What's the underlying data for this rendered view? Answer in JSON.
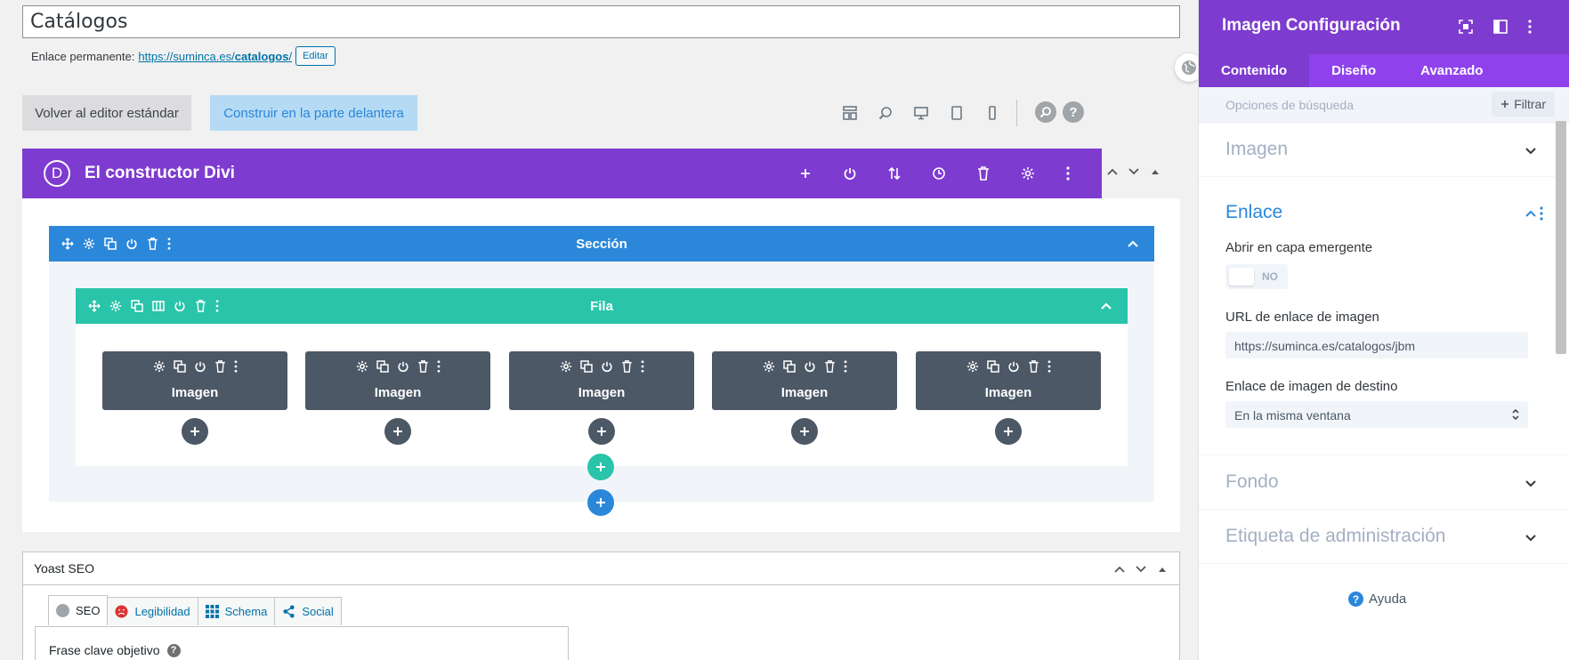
{
  "post_title": "Catálogos",
  "permalink": {
    "label": "Enlace permanente:",
    "url_prefix": "https://suminca.es/",
    "url_slug": "catalogos",
    "url_suffix": "/",
    "edit_label": "Editar"
  },
  "buttons": {
    "standard_editor": "Volver al editor estándar",
    "frontend_builder": "Construir en la parte delantera"
  },
  "builder": {
    "title": "El constructor Divi",
    "logo_letter": "D",
    "section_label": "Sección",
    "row_label": "Fila",
    "modules": [
      {
        "label": "Imagen"
      },
      {
        "label": "Imagen"
      },
      {
        "label": "Imagen"
      },
      {
        "label": "Imagen"
      },
      {
        "label": "Imagen"
      }
    ]
  },
  "help_glyph": "?",
  "yoast": {
    "title": "Yoast SEO",
    "tabs": [
      {
        "label": "SEO",
        "icon": "seo-circle-icon"
      },
      {
        "label": "Legibilidad",
        "icon": "sad-face-icon"
      },
      {
        "label": "Schema",
        "icon": "grid-icon"
      },
      {
        "label": "Social",
        "icon": "share-icon"
      }
    ],
    "focus_keyphrase_label": "Frase clave objetivo"
  },
  "panel": {
    "title": "Imagen Configuración",
    "tabs": [
      {
        "label": "Contenido"
      },
      {
        "label": "Diseño"
      },
      {
        "label": "Avanzado"
      }
    ],
    "search_placeholder": "Opciones de búsqueda",
    "filter_label": "Filtrar",
    "groups": {
      "imagen": "Imagen",
      "enlace": "Enlace",
      "fondo": "Fondo",
      "etiqueta": "Etiqueta de administración"
    },
    "fields": {
      "popup_label": "Abrir en capa emergente",
      "popup_value": "NO",
      "url_label": "URL de enlace de imagen",
      "url_value": "https://suminca.es/catalogos/jbm",
      "target_label": "Enlace de imagen de destino",
      "target_value": "En la misma ventana"
    },
    "help_label": "Ayuda"
  },
  "colors": {
    "divi_purple": "#7e3bd0",
    "section_blue": "#2b87da",
    "row_teal": "#29c4a9",
    "module_gray": "#4c5866"
  }
}
